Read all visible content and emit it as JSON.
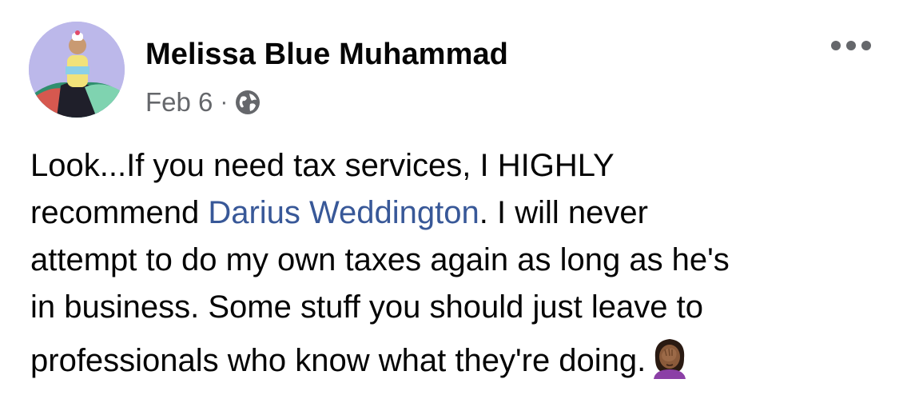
{
  "post": {
    "author": "Melissa Blue Muhammad",
    "date": "Feb 6",
    "separator": "·",
    "privacy_icon": "globe-icon",
    "more_icon": "more-options-icon",
    "text": {
      "line1": "Look...If you need tax services, I HIGHLY",
      "line2_before": "recommend ",
      "mention": "Darius Weddington",
      "line2_after": ". I will never",
      "line3": "attempt to do my own taxes again as long as he's",
      "line4": "in business. Some stuff you should just leave to",
      "line5": "professionals who know what they're doing."
    },
    "emoji": "face-palm-woman-emoji"
  },
  "colors": {
    "text": "#050505",
    "secondary": "#65676b",
    "link": "#385898"
  }
}
